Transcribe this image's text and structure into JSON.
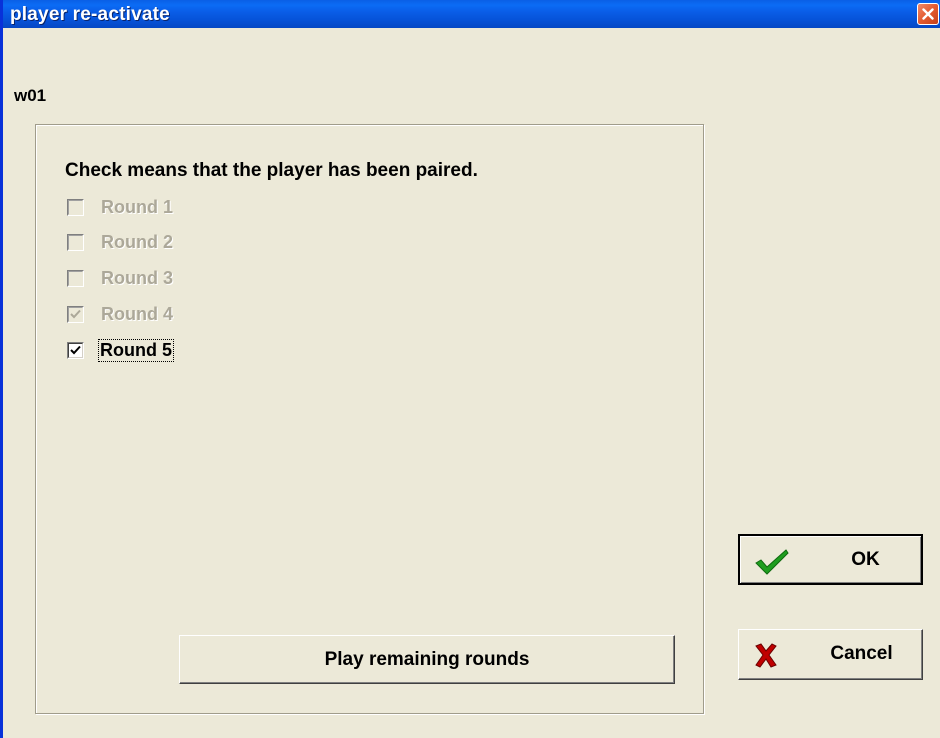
{
  "window": {
    "title": "player re-activate",
    "close_icon": "close-icon"
  },
  "player": {
    "name": "w01"
  },
  "group": {
    "instruction": "Check means that the player has been paired.",
    "rounds": [
      {
        "label": "Round 1",
        "checked": false,
        "enabled": false
      },
      {
        "label": "Round 2",
        "checked": false,
        "enabled": false
      },
      {
        "label": "Round 3",
        "checked": false,
        "enabled": false
      },
      {
        "label": "Round 4",
        "checked": true,
        "enabled": false
      },
      {
        "label": "Round 5",
        "checked": true,
        "enabled": true
      }
    ]
  },
  "buttons": {
    "play_remaining": "Play remaining rounds",
    "ok": "OK",
    "ok_icon": "checkmark-icon",
    "cancel": "Cancel",
    "cancel_icon": "red-x-icon"
  },
  "colors": {
    "titlebar": "#0a5fe6",
    "dialog_bg": "#ece9d8",
    "disabled_text": "#aca899",
    "ok_check": "#1f9e1f",
    "cancel_x": "#c00000"
  }
}
